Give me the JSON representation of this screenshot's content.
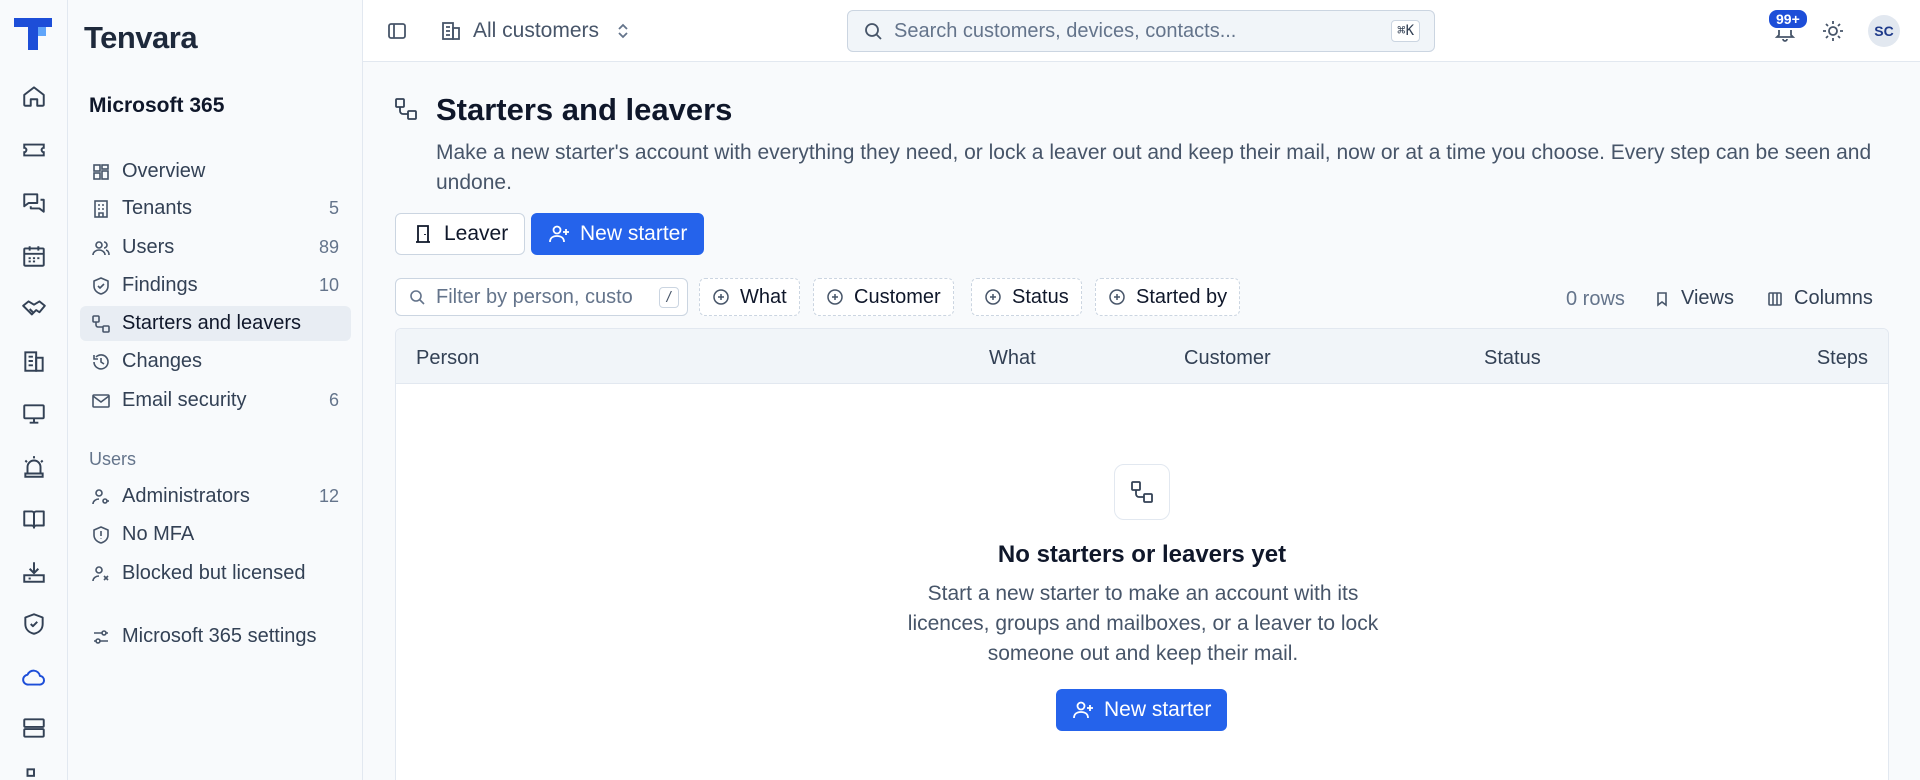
{
  "app": {
    "brand": "Tenvara"
  },
  "rail": [
    {
      "icon": "home-icon"
    },
    {
      "icon": "ticket-icon"
    },
    {
      "icon": "chat-icon"
    },
    {
      "icon": "calendar-icon"
    },
    {
      "icon": "handshake-icon"
    },
    {
      "icon": "building-icon"
    },
    {
      "icon": "monitor-icon"
    },
    {
      "icon": "alarm-icon"
    },
    {
      "icon": "book-icon"
    },
    {
      "icon": "download-tray-icon"
    },
    {
      "icon": "shield-check-icon"
    },
    {
      "icon": "cloud-icon",
      "active": true
    },
    {
      "icon": "server-icon"
    }
  ],
  "sidebar": {
    "title": "Microsoft 365",
    "items": [
      {
        "label": "Overview",
        "count": "",
        "icon": "grid-icon"
      },
      {
        "label": "Tenants",
        "count": "5",
        "icon": "building-icon"
      },
      {
        "label": "Users",
        "count": "89",
        "icon": "users-icon"
      },
      {
        "label": "Findings",
        "count": "10",
        "icon": "shield-check-icon"
      },
      {
        "label": "Starters and leavers",
        "count": "",
        "icon": "route-icon",
        "active": true
      },
      {
        "label": "Changes",
        "count": "",
        "icon": "history-icon"
      },
      {
        "label": "Email security",
        "count": "6",
        "icon": "mail-icon"
      }
    ],
    "group_label": "Users",
    "group_items": [
      {
        "label": "Administrators",
        "count": "12",
        "icon": "user-key-icon"
      },
      {
        "label": "No MFA",
        "count": "",
        "icon": "shield-alert-icon"
      },
      {
        "label": "Blocked but licensed",
        "count": "",
        "icon": "user-x-icon"
      }
    ],
    "settings_label": "Microsoft 365 settings"
  },
  "topbar": {
    "scope": "All customers",
    "search_placeholder": "Search customers, devices, contacts...",
    "search_shortcut": "⌘K",
    "notifications": "99+",
    "avatar": "SC"
  },
  "page": {
    "title": "Starters and leavers",
    "description": "Make a new starter's account with everything they need, or lock a leaver out and keep their mail, now or at a time you choose. Every step can be seen and undone.",
    "leaver_button": "Leaver",
    "starter_button": "New starter"
  },
  "filters": {
    "placeholder": "Filter by person, custo",
    "shortcut": "/",
    "chips": [
      "What",
      "Customer",
      "Status",
      "Started by"
    ],
    "rows": "0 rows",
    "views": "Views",
    "columns": "Columns"
  },
  "table": {
    "columns": [
      "Person",
      "What",
      "Customer",
      "Status",
      "Steps"
    ],
    "rows": []
  },
  "empty": {
    "title": "No starters or leavers yet",
    "description": "Start a new starter to make an account with its licences, groups and mailboxes, or a leaver to lock someone out and keep their mail.",
    "button": "New starter"
  },
  "colors": {
    "accent": "#2563eb",
    "brand": "#1d4ed8"
  }
}
